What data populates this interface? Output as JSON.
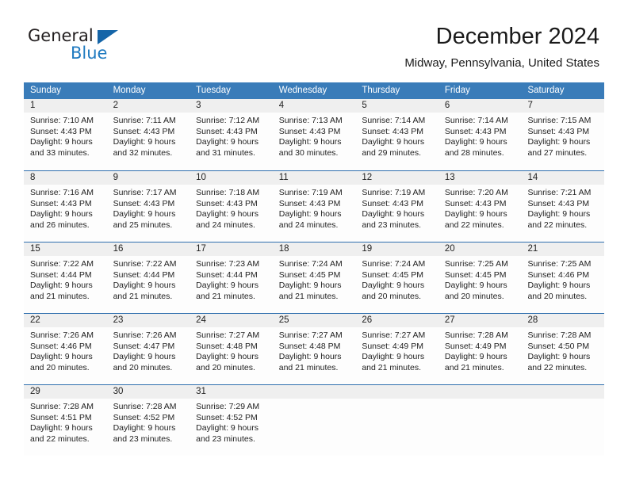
{
  "brand": {
    "name_part1": "General",
    "name_part2": "Blue",
    "accent_color": "#1f7ac0",
    "triangle_color": "#1565a8"
  },
  "header": {
    "month_title": "December 2024",
    "location": "Midway, Pennsylvania, United States"
  },
  "calendar": {
    "header_bg": "#3a7cb9",
    "daynum_bg": "#efefef",
    "separator_color": "#2f6fae",
    "weekdays": [
      "Sunday",
      "Monday",
      "Tuesday",
      "Wednesday",
      "Thursday",
      "Friday",
      "Saturday"
    ],
    "weeks": [
      [
        {
          "day": "1",
          "lines": [
            "Sunrise: 7:10 AM",
            "Sunset: 4:43 PM",
            "Daylight: 9 hours",
            "and 33 minutes."
          ]
        },
        {
          "day": "2",
          "lines": [
            "Sunrise: 7:11 AM",
            "Sunset: 4:43 PM",
            "Daylight: 9 hours",
            "and 32 minutes."
          ]
        },
        {
          "day": "3",
          "lines": [
            "Sunrise: 7:12 AM",
            "Sunset: 4:43 PM",
            "Daylight: 9 hours",
            "and 31 minutes."
          ]
        },
        {
          "day": "4",
          "lines": [
            "Sunrise: 7:13 AM",
            "Sunset: 4:43 PM",
            "Daylight: 9 hours",
            "and 30 minutes."
          ]
        },
        {
          "day": "5",
          "lines": [
            "Sunrise: 7:14 AM",
            "Sunset: 4:43 PM",
            "Daylight: 9 hours",
            "and 29 minutes."
          ]
        },
        {
          "day": "6",
          "lines": [
            "Sunrise: 7:14 AM",
            "Sunset: 4:43 PM",
            "Daylight: 9 hours",
            "and 28 minutes."
          ]
        },
        {
          "day": "7",
          "lines": [
            "Sunrise: 7:15 AM",
            "Sunset: 4:43 PM",
            "Daylight: 9 hours",
            "and 27 minutes."
          ]
        }
      ],
      [
        {
          "day": "8",
          "lines": [
            "Sunrise: 7:16 AM",
            "Sunset: 4:43 PM",
            "Daylight: 9 hours",
            "and 26 minutes."
          ]
        },
        {
          "day": "9",
          "lines": [
            "Sunrise: 7:17 AM",
            "Sunset: 4:43 PM",
            "Daylight: 9 hours",
            "and 25 minutes."
          ]
        },
        {
          "day": "10",
          "lines": [
            "Sunrise: 7:18 AM",
            "Sunset: 4:43 PM",
            "Daylight: 9 hours",
            "and 24 minutes."
          ]
        },
        {
          "day": "11",
          "lines": [
            "Sunrise: 7:19 AM",
            "Sunset: 4:43 PM",
            "Daylight: 9 hours",
            "and 24 minutes."
          ]
        },
        {
          "day": "12",
          "lines": [
            "Sunrise: 7:19 AM",
            "Sunset: 4:43 PM",
            "Daylight: 9 hours",
            "and 23 minutes."
          ]
        },
        {
          "day": "13",
          "lines": [
            "Sunrise: 7:20 AM",
            "Sunset: 4:43 PM",
            "Daylight: 9 hours",
            "and 22 minutes."
          ]
        },
        {
          "day": "14",
          "lines": [
            "Sunrise: 7:21 AM",
            "Sunset: 4:43 PM",
            "Daylight: 9 hours",
            "and 22 minutes."
          ]
        }
      ],
      [
        {
          "day": "15",
          "lines": [
            "Sunrise: 7:22 AM",
            "Sunset: 4:44 PM",
            "Daylight: 9 hours",
            "and 21 minutes."
          ]
        },
        {
          "day": "16",
          "lines": [
            "Sunrise: 7:22 AM",
            "Sunset: 4:44 PM",
            "Daylight: 9 hours",
            "and 21 minutes."
          ]
        },
        {
          "day": "17",
          "lines": [
            "Sunrise: 7:23 AM",
            "Sunset: 4:44 PM",
            "Daylight: 9 hours",
            "and 21 minutes."
          ]
        },
        {
          "day": "18",
          "lines": [
            "Sunrise: 7:24 AM",
            "Sunset: 4:45 PM",
            "Daylight: 9 hours",
            "and 21 minutes."
          ]
        },
        {
          "day": "19",
          "lines": [
            "Sunrise: 7:24 AM",
            "Sunset: 4:45 PM",
            "Daylight: 9 hours",
            "and 20 minutes."
          ]
        },
        {
          "day": "20",
          "lines": [
            "Sunrise: 7:25 AM",
            "Sunset: 4:45 PM",
            "Daylight: 9 hours",
            "and 20 minutes."
          ]
        },
        {
          "day": "21",
          "lines": [
            "Sunrise: 7:25 AM",
            "Sunset: 4:46 PM",
            "Daylight: 9 hours",
            "and 20 minutes."
          ]
        }
      ],
      [
        {
          "day": "22",
          "lines": [
            "Sunrise: 7:26 AM",
            "Sunset: 4:46 PM",
            "Daylight: 9 hours",
            "and 20 minutes."
          ]
        },
        {
          "day": "23",
          "lines": [
            "Sunrise: 7:26 AM",
            "Sunset: 4:47 PM",
            "Daylight: 9 hours",
            "and 20 minutes."
          ]
        },
        {
          "day": "24",
          "lines": [
            "Sunrise: 7:27 AM",
            "Sunset: 4:48 PM",
            "Daylight: 9 hours",
            "and 20 minutes."
          ]
        },
        {
          "day": "25",
          "lines": [
            "Sunrise: 7:27 AM",
            "Sunset: 4:48 PM",
            "Daylight: 9 hours",
            "and 21 minutes."
          ]
        },
        {
          "day": "26",
          "lines": [
            "Sunrise: 7:27 AM",
            "Sunset: 4:49 PM",
            "Daylight: 9 hours",
            "and 21 minutes."
          ]
        },
        {
          "day": "27",
          "lines": [
            "Sunrise: 7:28 AM",
            "Sunset: 4:49 PM",
            "Daylight: 9 hours",
            "and 21 minutes."
          ]
        },
        {
          "day": "28",
          "lines": [
            "Sunrise: 7:28 AM",
            "Sunset: 4:50 PM",
            "Daylight: 9 hours",
            "and 22 minutes."
          ]
        }
      ],
      [
        {
          "day": "29",
          "lines": [
            "Sunrise: 7:28 AM",
            "Sunset: 4:51 PM",
            "Daylight: 9 hours",
            "and 22 minutes."
          ]
        },
        {
          "day": "30",
          "lines": [
            "Sunrise: 7:28 AM",
            "Sunset: 4:52 PM",
            "Daylight: 9 hours",
            "and 23 minutes."
          ]
        },
        {
          "day": "31",
          "lines": [
            "Sunrise: 7:29 AM",
            "Sunset: 4:52 PM",
            "Daylight: 9 hours",
            "and 23 minutes."
          ]
        },
        {
          "day": "",
          "lines": []
        },
        {
          "day": "",
          "lines": []
        },
        {
          "day": "",
          "lines": []
        },
        {
          "day": "",
          "lines": []
        }
      ]
    ]
  }
}
